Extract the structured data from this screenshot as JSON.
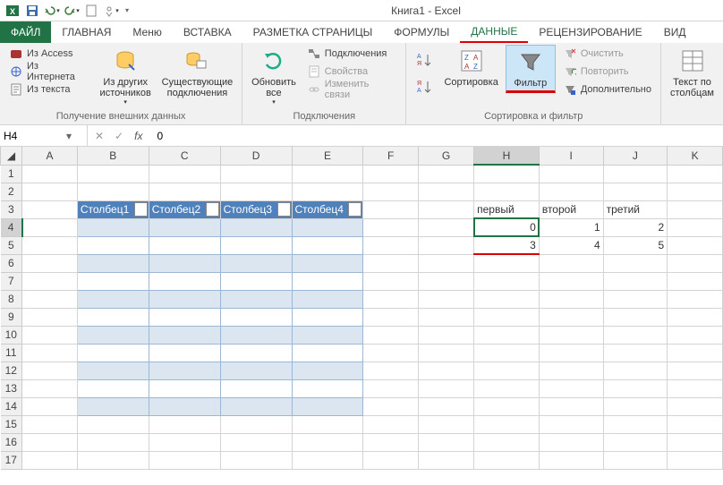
{
  "app_title": "Книга1 - Excel",
  "qat": {
    "items": [
      "excel-icon",
      "save-icon",
      "undo-icon",
      "redo-icon",
      "new-icon",
      "touch-icon"
    ]
  },
  "tabs": {
    "file": "ФАЙЛ",
    "home": "ГЛАВНАЯ",
    "menu": "Меню",
    "insert": "ВСТАВКА",
    "pagelayout": "РАЗМЕТКА СТРАНИЦЫ",
    "formulas": "ФОРМУЛЫ",
    "data": "ДАННЫЕ",
    "review": "РЕЦЕНЗИРОВАНИЕ",
    "view": "ВИД"
  },
  "ribbon": {
    "g1": {
      "access": "Из Access",
      "web": "Из Интернета",
      "text": "Из текста",
      "other": "Из других\nисточников",
      "existing": "Существующие\nподключения",
      "label": "Получение внешних данных"
    },
    "g2": {
      "refresh": "Обновить\nвсе",
      "connections": "Подключения",
      "properties": "Свойства",
      "editlinks": "Изменить связи",
      "label": "Подключения"
    },
    "g3": {
      "sort": "Сортировка",
      "filter": "Фильтр",
      "clear": "Очистить",
      "reapply": "Повторить",
      "advanced": "Дополнительно",
      "label": "Сортировка и фильтр"
    },
    "g4": {
      "texttocol": "Текст по\nстолбцам"
    }
  },
  "namebox": "H4",
  "formula": "0",
  "columns": [
    "A",
    "B",
    "C",
    "D",
    "E",
    "F",
    "G",
    "H",
    "I",
    "J",
    "K"
  ],
  "table_headers": [
    "Столбец1",
    "Столбец2",
    "Столбец3",
    "Столбец4"
  ],
  "side_headers": [
    "первый",
    "второй",
    "третий"
  ],
  "side_data": [
    [
      0,
      1,
      2
    ],
    [
      3,
      4,
      5
    ]
  ]
}
